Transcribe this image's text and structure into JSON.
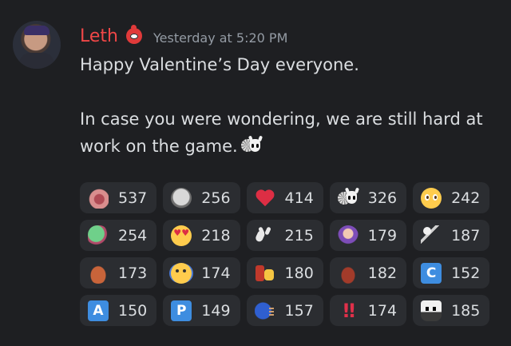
{
  "message": {
    "username": "Leth",
    "timestamp": "Yesterday at 5:20 PM",
    "lines": [
      "Happy Valentine’s Day everyone.",
      "In case you were wondering, we are still hard at work on the game."
    ],
    "inline_emoji_icon": "fan-knight-emoji"
  },
  "reactions": [
    [
      {
        "icon": "open-mouth-emoji",
        "count": "537"
      },
      {
        "icon": "skull-emoji",
        "count": "256"
      },
      {
        "icon": "red-heart-emoji",
        "count": "414"
      },
      {
        "icon": "fan-knight-emoji",
        "count": "326"
      },
      {
        "icon": "pleading-face-emoji",
        "count": "242"
      }
    ],
    [
      {
        "icon": "green-bug-emoji",
        "count": "254"
      },
      {
        "icon": "heart-eyes-emoji",
        "count": "218"
      },
      {
        "icon": "knight-horns-emoji",
        "count": "215"
      },
      {
        "icon": "purple-hooded-emoji",
        "count": "179"
      },
      {
        "icon": "sword-knight-emoji",
        "count": "187"
      }
    ],
    [
      {
        "icon": "crab-emoji",
        "count": "173"
      },
      {
        "icon": "shaking-face-emoji",
        "count": "174"
      },
      {
        "icon": "knight-thumbs-up-emoji",
        "count": "180"
      },
      {
        "icon": "red-bug-emoji",
        "count": "182"
      },
      {
        "icon": "letter-c-emoji",
        "count": "152",
        "letter": "C"
      }
    ],
    [
      {
        "icon": "letter-a-emoji",
        "count": "150",
        "letter": "A"
      },
      {
        "icon": "letter-p-emoji",
        "count": "149",
        "letter": "P"
      },
      {
        "icon": "speaking-head-emoji",
        "count": "157"
      },
      {
        "icon": "double-exclamation-emoji",
        "count": "174",
        "glyph": "‼"
      },
      {
        "icon": "pale-king-emoji",
        "count": "185"
      }
    ]
  ]
}
